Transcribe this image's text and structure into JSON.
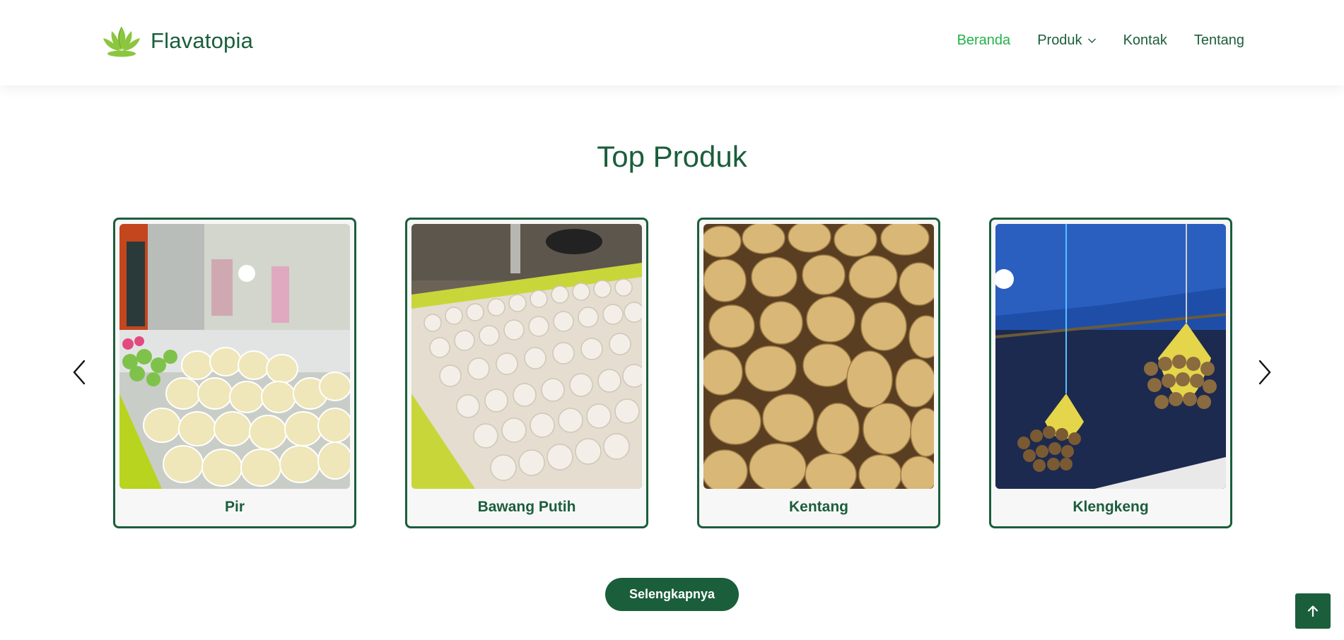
{
  "brand": {
    "name": "Flavatopia",
    "logo_icon": "lotus-logo-icon"
  },
  "nav": {
    "items": [
      {
        "label": "Beranda",
        "active": true
      },
      {
        "label": "Produk",
        "has_dropdown": true,
        "icon": "chevron-down-icon"
      },
      {
        "label": "Kontak"
      },
      {
        "label": "Tentang"
      }
    ]
  },
  "section": {
    "title": "Top Produk"
  },
  "carousel": {
    "prev_icon": "chevron-left-icon",
    "next_icon": "chevron-right-icon",
    "products": [
      {
        "name": "Pir"
      },
      {
        "name": "Bawang Putih"
      },
      {
        "name": "Kentang"
      },
      {
        "name": "Klengkeng"
      }
    ]
  },
  "cta": {
    "label": "Selengkapnya"
  },
  "back_to_top": {
    "icon": "arrow-up-icon"
  },
  "colors": {
    "primary": "#1b5e3b",
    "active_nav": "#22b34a",
    "logo": "#8cc63f"
  }
}
